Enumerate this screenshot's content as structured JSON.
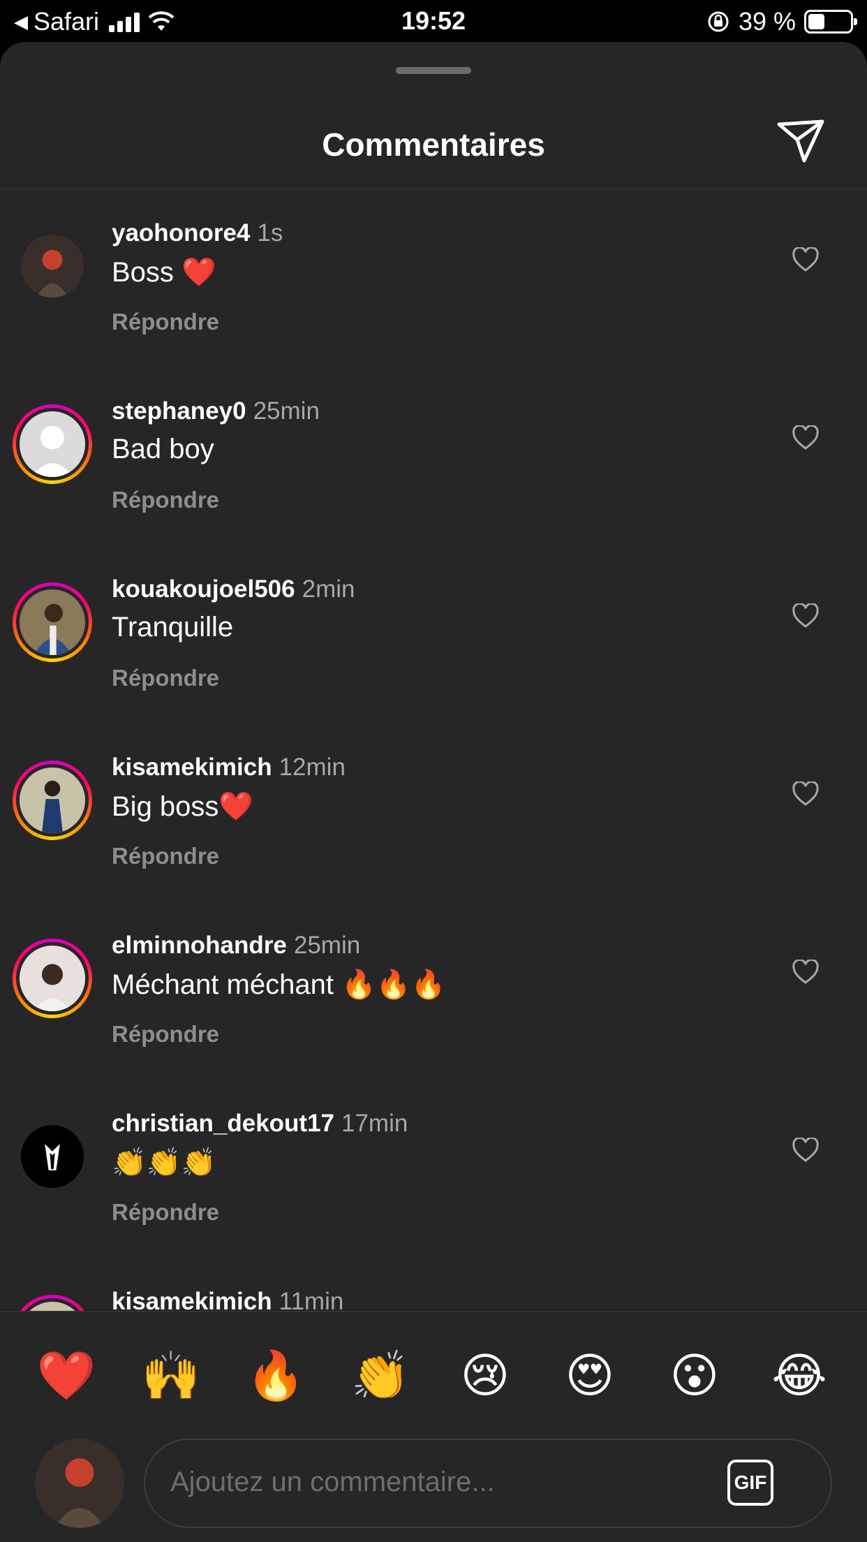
{
  "status_bar": {
    "back_app": "Safari",
    "time": "19:52",
    "battery_text": "39 %",
    "battery_level": 0.39
  },
  "sheet": {
    "title": "Commentaires"
  },
  "comments": [
    {
      "username": "yaohonore4",
      "time": "1s",
      "text": "Boss ❤️",
      "reply_label": "Répondre"
    },
    {
      "username": "stephaney0",
      "time": "25min",
      "text": "Bad boy",
      "reply_label": "Répondre"
    },
    {
      "username": "kouakoujoel506",
      "time": "2min",
      "text": "Tranquille",
      "reply_label": "Répondre"
    },
    {
      "username": "kisamekimich",
      "time": "12min",
      "text": "Big boss❤️",
      "reply_label": "Répondre"
    },
    {
      "username": "elminnohandre",
      "time": "25min",
      "text": "Méchant méchant 🔥🔥🔥",
      "reply_label": "Répondre"
    },
    {
      "username": "christian_dekout17",
      "time": "17min",
      "text": "👏👏👏",
      "reply_label": "Répondre"
    },
    {
      "username": "kisamekimich",
      "time": "11min",
      "text": "",
      "reply_label": ""
    }
  ],
  "reactions": [
    "❤️",
    "🙌",
    "🔥",
    "👏",
    "😢",
    "😍",
    "😮",
    "😂"
  ],
  "composer": {
    "placeholder": "Ajoutez un commentaire...",
    "gif_label": "GIF"
  },
  "colors": {
    "background": "#262626",
    "secondary_text": "#a8a8a8",
    "reply_text": "#8e8e8e",
    "story_ring": "#ff0069"
  },
  "icons": {
    "send": "paper-plane-icon",
    "like": "heart-outline-icon",
    "gif": "gif-icon"
  }
}
